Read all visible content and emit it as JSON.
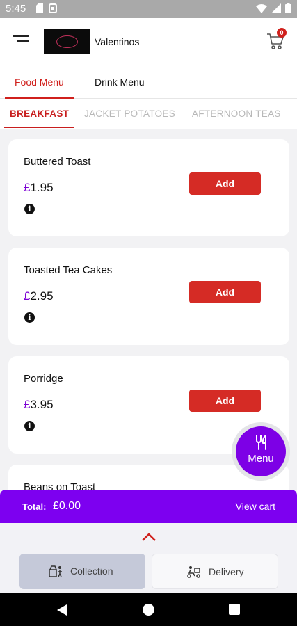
{
  "status_bar": {
    "time": "5:45"
  },
  "header": {
    "brand_name": "Valentinos",
    "cart_count": "0"
  },
  "menu_tabs": [
    {
      "label": "Food Menu",
      "active": true
    },
    {
      "label": "Drink Menu",
      "active": false
    }
  ],
  "category_tabs": [
    {
      "label": "BREAKFAST",
      "active": true
    },
    {
      "label": "JACKET POTATOES",
      "active": false
    },
    {
      "label": "AFTERNOON TEAS",
      "active": false
    }
  ],
  "items": [
    {
      "name": "Buttered Toast",
      "currency": "£",
      "price": "1.95",
      "add_label": "Add",
      "info_icon": "i"
    },
    {
      "name": "Toasted Tea Cakes",
      "currency": "£",
      "price": "2.95",
      "add_label": "Add",
      "info_icon": "i"
    },
    {
      "name": "Porridge",
      "currency": "£",
      "price": "3.95",
      "add_label": "Add",
      "info_icon": "i"
    },
    {
      "name": "Beans on Toast"
    }
  ],
  "fab": {
    "label": "Menu"
  },
  "total_bar": {
    "label": "Total:",
    "value": "£0.00",
    "view_cart": "View cart"
  },
  "order_modes": [
    {
      "label": "Collection",
      "selected": true
    },
    {
      "label": "Delivery",
      "selected": false
    }
  ],
  "colors": {
    "accent_red": "#d52b25",
    "accent_purple": "#7d00f0",
    "price_currency": "#7b00d4"
  }
}
